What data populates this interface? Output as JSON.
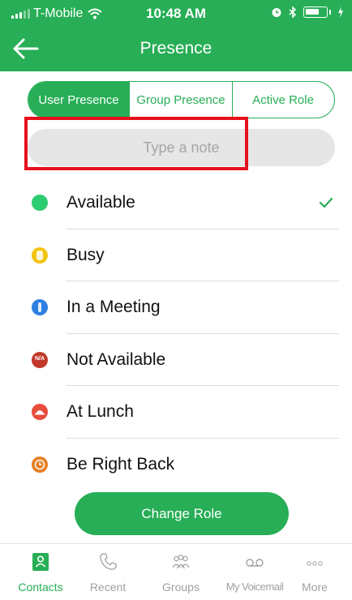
{
  "status_bar": {
    "carrier": "T-Mobile",
    "time": "10:48 AM"
  },
  "nav": {
    "title": "Presence"
  },
  "segments": [
    {
      "label": "User Presence",
      "active": true
    },
    {
      "label": "Group Presence",
      "active": false
    },
    {
      "label": "Active Role",
      "active": false
    }
  ],
  "note": {
    "placeholder": "Type a note"
  },
  "statuses": [
    {
      "label": "Available",
      "color": "#2ecc71",
      "selected": true
    },
    {
      "label": "Busy",
      "color": "#f1c40f",
      "selected": false
    },
    {
      "label": "In a Meeting",
      "color": "#2f7fe0",
      "selected": false
    },
    {
      "label": "Not Available",
      "color": "#c0392b",
      "badge": "N/A",
      "selected": false
    },
    {
      "label": "At Lunch",
      "color": "#e74c3c",
      "selected": false
    },
    {
      "label": "Be Right Back",
      "color": "#e67e22",
      "selected": false
    }
  ],
  "actions": {
    "change_role": "Change Role"
  },
  "tabs": [
    {
      "label": "Contacts",
      "icon": "contacts-icon",
      "active": true
    },
    {
      "label": "Recent",
      "icon": "phone-icon",
      "active": false
    },
    {
      "label": "Groups",
      "icon": "groups-icon",
      "active": false
    },
    {
      "label": "My Voicemail",
      "icon": "voicemail-icon",
      "active": false
    },
    {
      "label": "More",
      "icon": "more-icon",
      "active": false
    }
  ],
  "colors": {
    "accent": "#27ae56",
    "highlight": "#e6101b"
  }
}
